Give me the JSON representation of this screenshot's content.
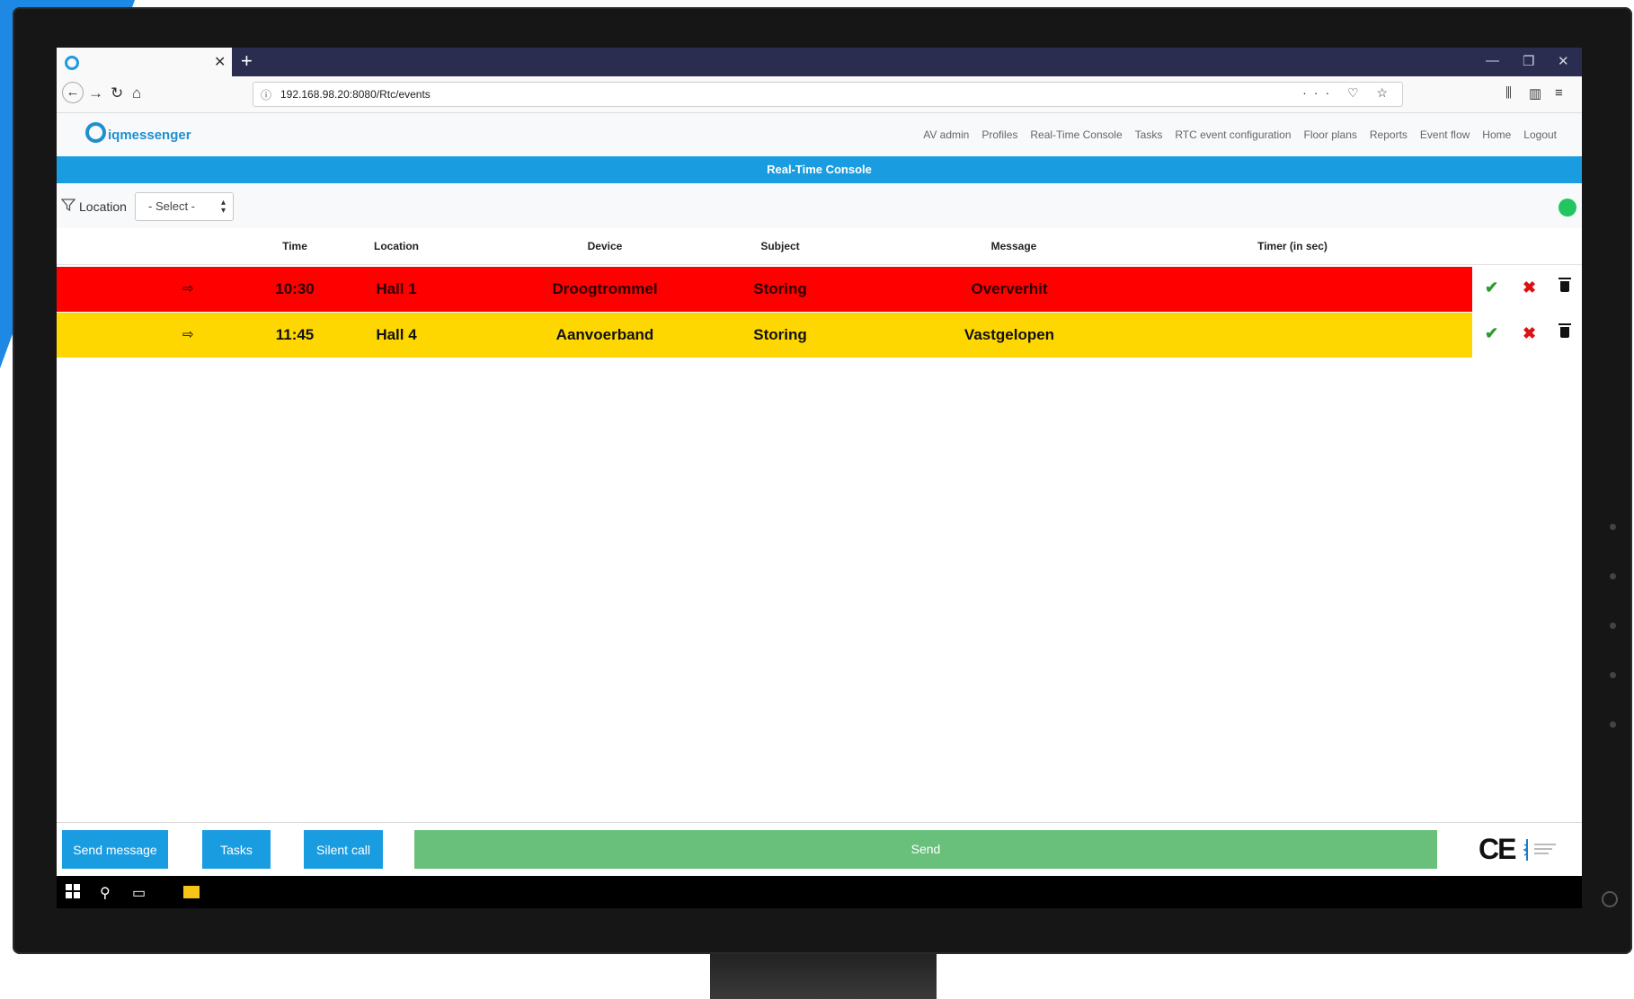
{
  "browser": {
    "url": "192.168.98.20:8080/Rtc/events",
    "url_icons": "··· ♡ ☆"
  },
  "app": {
    "logo_text": "iqmessenger",
    "menu": [
      "AV admin",
      "Profiles",
      "Real-Time Console",
      "Tasks",
      "RTC event configuration",
      "Floor plans",
      "Reports",
      "Event flow",
      "Home",
      "Logout"
    ],
    "page_title": "Real-Time Console"
  },
  "filter": {
    "label": "Location",
    "select_value": "- Select -"
  },
  "status_color": "#22c55e",
  "table": {
    "headers": {
      "time": "Time",
      "location": "Location",
      "device": "Device",
      "subject": "Subject",
      "message": "Message",
      "timer": "Timer (in sec)"
    },
    "rows": [
      {
        "color": "#ff0000",
        "time": "10:30",
        "location": "Hall 1",
        "device": "Droogtrommel",
        "subject": "Storing",
        "message": "Oververhit"
      },
      {
        "color": "#ffd700",
        "time": "11:45",
        "location": "Hall 4",
        "device": "Aanvoerband",
        "subject": "Storing",
        "message": "Vastgelopen"
      }
    ]
  },
  "bottom": {
    "send_message": "Send message",
    "tasks": "Tasks",
    "silent_call": "Silent call",
    "send": "Send",
    "ce_mark": "CE"
  }
}
